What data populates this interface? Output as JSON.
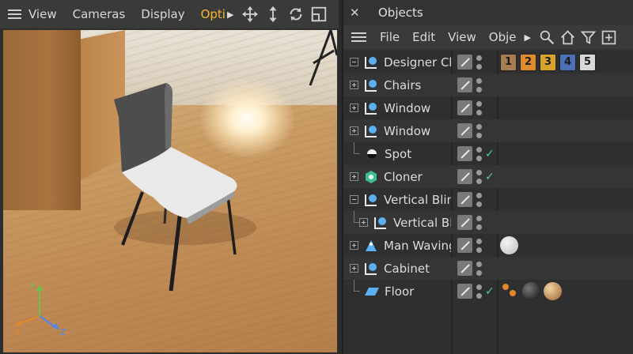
{
  "viewport": {
    "menu": [
      "View",
      "Cameras",
      "Display",
      "Opti"
    ],
    "active_menu_index": 3,
    "axis": {
      "y": "Y",
      "x": "X",
      "z": "Z"
    }
  },
  "objects_panel": {
    "title": "Objects",
    "menu": [
      "File",
      "Edit",
      "View",
      "Obje"
    ],
    "rows": [
      {
        "name": "Designer Ch",
        "icon": "null-icon",
        "expander": "minus",
        "check": false
      },
      {
        "name": "Chairs",
        "icon": "null-icon",
        "expander": "plus",
        "check": false
      },
      {
        "name": "Window",
        "icon": "null-icon",
        "expander": "plus",
        "check": false
      },
      {
        "name": "Window",
        "icon": "null-icon",
        "expander": "plus",
        "check": false
      },
      {
        "name": "Spot",
        "icon": "spot-light-icon",
        "expander": "none",
        "check": true
      },
      {
        "name": "Cloner",
        "icon": "cloner-icon",
        "expander": "plus",
        "check": true
      },
      {
        "name": "Vertical Blinc",
        "icon": "null-icon",
        "expander": "minus",
        "check": false
      },
      {
        "name": "Vertical Bl",
        "icon": "null-icon",
        "expander": "plus",
        "indent": true,
        "check": false
      },
      {
        "name": "Man Waving",
        "icon": "figure-icon",
        "expander": "plus",
        "check": false
      },
      {
        "name": "Cabinet",
        "icon": "null-icon",
        "expander": "plus",
        "check": false
      },
      {
        "name": "Floor",
        "icon": "floor-icon",
        "expander": "none",
        "check": true
      }
    ],
    "layer_tags": [
      {
        "label": "1",
        "color": "#a67c52"
      },
      {
        "label": "2",
        "color": "#e08a2e"
      },
      {
        "label": "3",
        "color": "#d9a22c"
      },
      {
        "label": "4",
        "color": "#4d6fb5"
      },
      {
        "label": "5",
        "color": "#d8d8d8"
      }
    ],
    "colors": {
      "accent": "#f5b82e",
      "check": "#4fd08f",
      "null_icon": "#5ab0f0"
    }
  }
}
